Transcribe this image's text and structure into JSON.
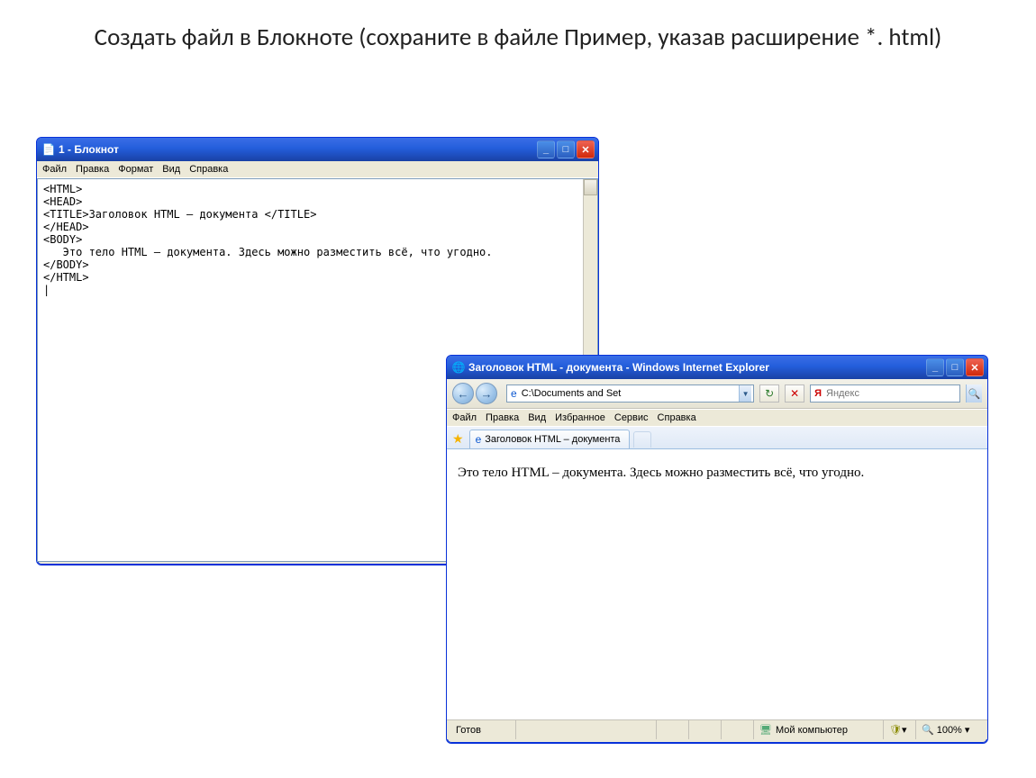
{
  "slide_title": "Создать файл в Блокноте (сохраните в файле  Пример,  указав расширение  *. html)",
  "notepad": {
    "title": "1 - Блокнот",
    "menu": [
      "Файл",
      "Правка",
      "Формат",
      "Вид",
      "Справка"
    ],
    "content": "<HTML>\n<HEAD>\n<TITLE>Заголовок HTML – документа </TITLE>\n</HEAD>\n<BODY>\n   Это тело HTML – документа. Здесь можно разместить всё, что угодно.\n</BODY>\n</HTML>\n|"
  },
  "ie": {
    "title": "Заголовок HTML - документа - Windows Internet Explorer",
    "address": "C:\\Documents and Set",
    "search_placeholder": "Яндекс",
    "menu": [
      "Файл",
      "Правка",
      "Вид",
      "Избранное",
      "Сервис",
      "Справка"
    ],
    "tab_label": "Заголовок HTML – документа",
    "page_body": "Это тело HTML – документа. Здесь можно разместить всё, что угодно.",
    "status": {
      "ready": "Готов",
      "zone": "Мой компьютер",
      "zoom": "100%"
    }
  }
}
